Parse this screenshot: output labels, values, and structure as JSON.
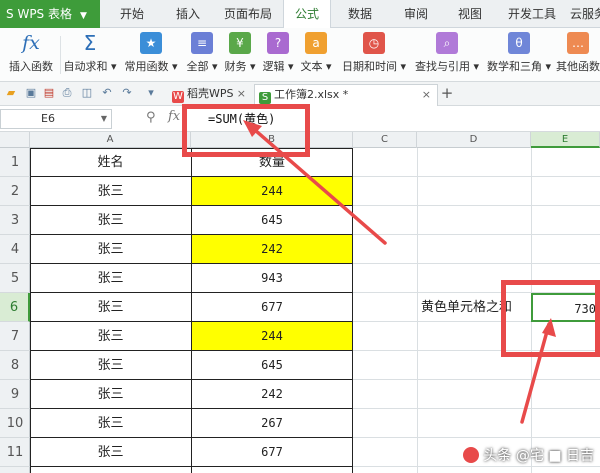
{
  "app": {
    "title": "WPS 表格"
  },
  "tabs": [
    "开始",
    "插入",
    "页面布局",
    "公式",
    "数据",
    "审阅",
    "视图",
    "开发工具",
    "云服务"
  ],
  "active_tab": "公式",
  "ribbon": {
    "items": [
      {
        "label": "插入函数",
        "icon": "fx-icon"
      },
      {
        "label": "自动求和 ▾",
        "icon": "sigma-icon"
      },
      {
        "label": "常用函数 ▾",
        "icon": "star-book-icon",
        "glyph": "★"
      },
      {
        "label": "全部 ▾",
        "icon": "all-functions-icon",
        "glyph": "≡"
      },
      {
        "label": "财务 ▾",
        "icon": "finance-icon",
        "glyph": "¥"
      },
      {
        "label": "逻辑 ▾",
        "icon": "logic-icon",
        "glyph": "?"
      },
      {
        "label": "文本 ▾",
        "icon": "text-icon",
        "glyph": "a"
      },
      {
        "label": "日期和时间 ▾",
        "icon": "clock-icon",
        "glyph": "◷"
      },
      {
        "label": "查找与引用 ▾",
        "icon": "lookup-icon",
        "glyph": "⌕"
      },
      {
        "label": "数学和三角 ▾",
        "icon": "math-icon",
        "glyph": "θ"
      },
      {
        "label": "其他函数",
        "icon": "other-functions-icon",
        "glyph": "…"
      }
    ]
  },
  "doc_tabs": [
    {
      "label": "稻壳WPS",
      "close": "×"
    },
    {
      "label": "工作簿2.xlsx *",
      "close": "×"
    }
  ],
  "add_tab": "+",
  "formula_bar": {
    "cell_ref": "E6",
    "fx": "fx",
    "formula": "=SUM(黄色)"
  },
  "columns": [
    "A",
    "B",
    "C",
    "D",
    "E"
  ],
  "selected_column": "E",
  "rows": [
    "1",
    "2",
    "3",
    "4",
    "5",
    "6",
    "7",
    "8",
    "9",
    "10",
    "11"
  ],
  "selected_row": "6",
  "table": {
    "header_name": "姓名",
    "header_qty": "数量",
    "records": [
      {
        "name": "张三",
        "qty": "244",
        "highlight": true
      },
      {
        "name": "张三",
        "qty": "645",
        "highlight": false
      },
      {
        "name": "张三",
        "qty": "242",
        "highlight": true
      },
      {
        "name": "张三",
        "qty": "943",
        "highlight": false
      },
      {
        "name": "张三",
        "qty": "677",
        "highlight": false
      },
      {
        "name": "张三",
        "qty": "244",
        "highlight": true
      },
      {
        "name": "张三",
        "qty": "645",
        "highlight": false
      },
      {
        "name": "张三",
        "qty": "242",
        "highlight": false
      },
      {
        "name": "张三",
        "qty": "267",
        "highlight": false
      },
      {
        "name": "张三",
        "qty": "677",
        "highlight": false
      }
    ]
  },
  "result": {
    "label": "黄色单元格之和",
    "value": "730"
  },
  "watermark": "头条 @宅 ■ 日吉",
  "colors": {
    "highlight": "#ffff00",
    "annotation": "#e84a4a",
    "app_green": "#3e9c3a",
    "selected_header": "#d9ecd4"
  }
}
